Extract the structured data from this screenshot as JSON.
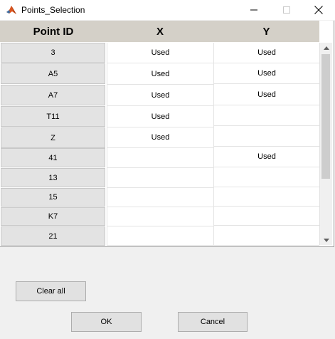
{
  "window": {
    "title": "Points_Selection"
  },
  "table": {
    "headers": [
      "Point ID",
      "X",
      "Y"
    ],
    "rows": [
      {
        "id": "3",
        "x": "Used",
        "y": "Used"
      },
      {
        "id": "A5",
        "x": "Used",
        "y": "Used"
      },
      {
        "id": "A7",
        "x": "Used",
        "y": "Used"
      },
      {
        "id": "T11",
        "x": "Used",
        "y": ""
      },
      {
        "id": "Z",
        "x": "Used",
        "y": ""
      },
      {
        "id": "41",
        "x": "",
        "y": "Used"
      },
      {
        "id": "13",
        "x": "",
        "y": ""
      },
      {
        "id": "15",
        "x": "",
        "y": ""
      },
      {
        "id": "K7",
        "x": "",
        "y": ""
      },
      {
        "id": "21",
        "x": "",
        "y": ""
      }
    ]
  },
  "buttons": {
    "clear_all": "Clear all",
    "ok": "OK",
    "cancel": "Cancel"
  },
  "icons": {
    "app": "matlab-icon",
    "minimize": "minimize-icon",
    "maximize": "maximize-icon",
    "close": "close-icon"
  }
}
